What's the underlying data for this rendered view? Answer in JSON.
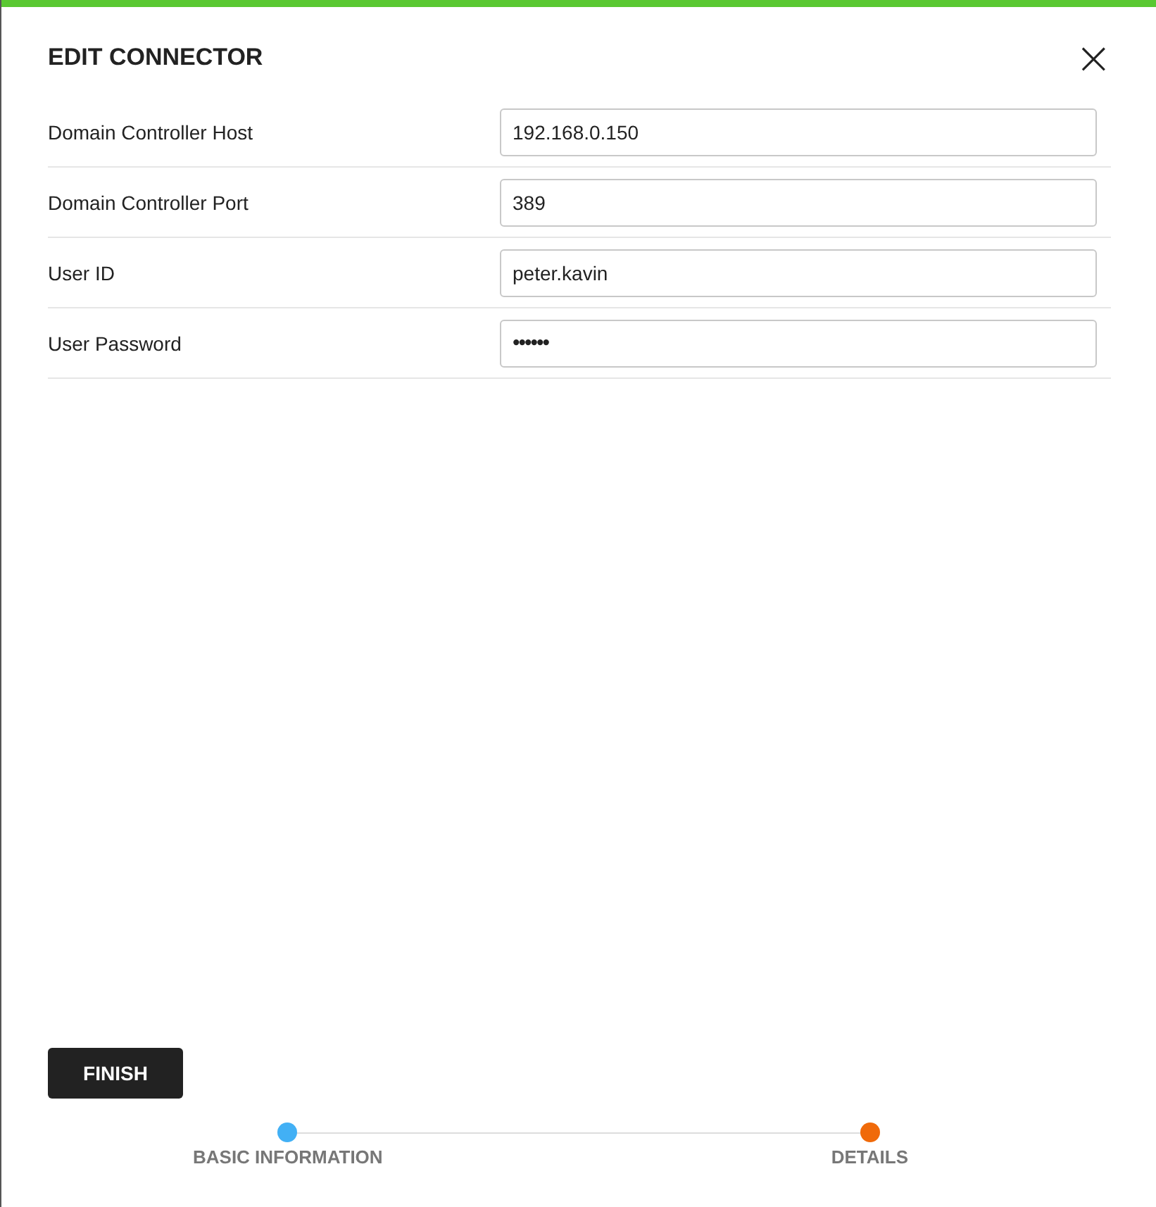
{
  "dialog": {
    "title": "EDIT CONNECTOR",
    "close": "×"
  },
  "fields": [
    {
      "label": "Domain Controller Host",
      "value": "192.168.0.150",
      "kind": "text"
    },
    {
      "label": "Domain Controller Port",
      "value": "389",
      "kind": "text"
    },
    {
      "label": "User ID",
      "value": "peter.kavin",
      "kind": "text"
    },
    {
      "label": "User Password",
      "value": "••••••",
      "kind": "password"
    }
  ],
  "finish_button": "FINISH",
  "steps": [
    {
      "label": "BASIC INFORMATION",
      "color": "#42b0f5"
    },
    {
      "label": "DETAILS",
      "color": "#f06a0a"
    }
  ]
}
